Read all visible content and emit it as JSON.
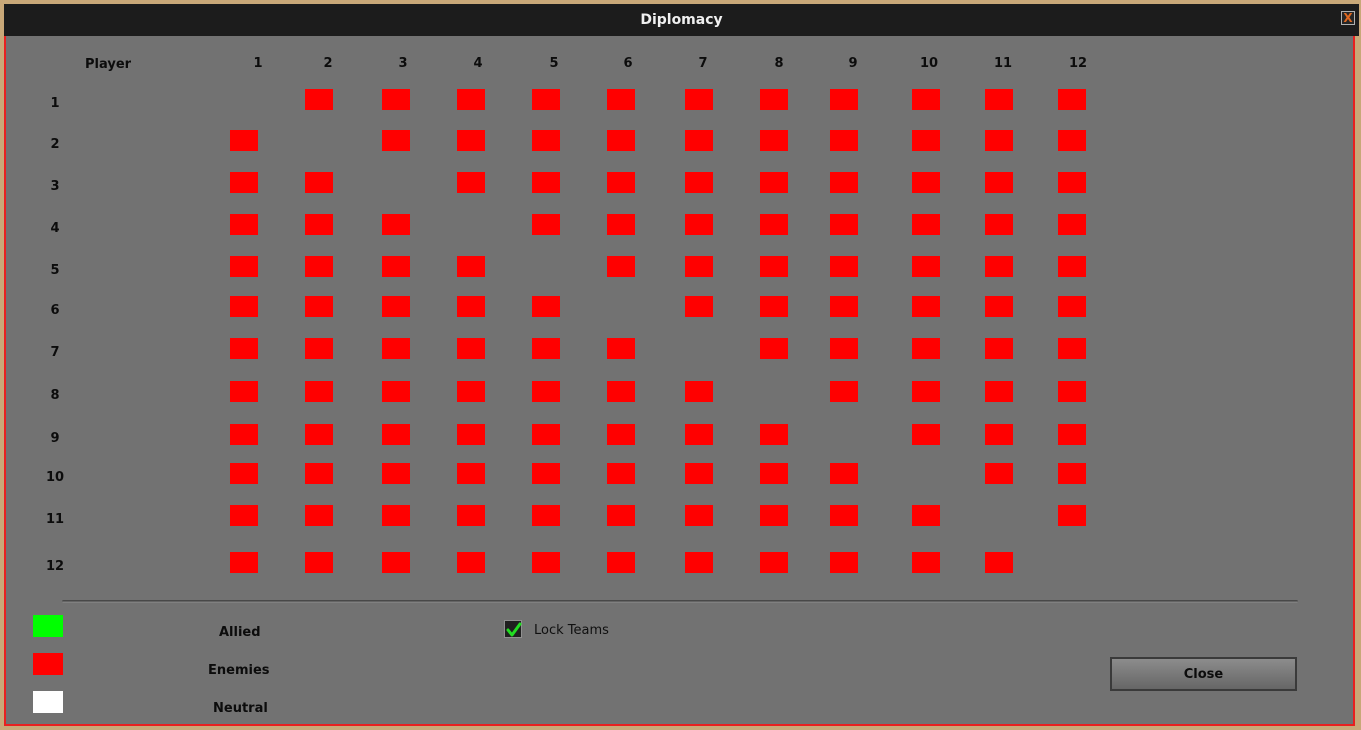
{
  "window": {
    "title": "Diplomacy",
    "close_glyph": "X"
  },
  "matrix": {
    "header": "Player",
    "cols": [
      "1",
      "2",
      "3",
      "4",
      "5",
      "6",
      "7",
      "8",
      "9",
      "10",
      "11",
      "12"
    ],
    "rows": [
      "1",
      "2",
      "3",
      "4",
      "5",
      "6",
      "7",
      "8",
      "9",
      "10",
      "11",
      "12"
    ],
    "relation_grid": [
      [
        "self",
        "enemy",
        "enemy",
        "enemy",
        "enemy",
        "enemy",
        "enemy",
        "enemy",
        "enemy",
        "enemy",
        "enemy",
        "enemy"
      ],
      [
        "enemy",
        "self",
        "enemy",
        "enemy",
        "enemy",
        "enemy",
        "enemy",
        "enemy",
        "enemy",
        "enemy",
        "enemy",
        "enemy"
      ],
      [
        "enemy",
        "enemy",
        "self",
        "enemy",
        "enemy",
        "enemy",
        "enemy",
        "enemy",
        "enemy",
        "enemy",
        "enemy",
        "enemy"
      ],
      [
        "enemy",
        "enemy",
        "enemy",
        "self",
        "enemy",
        "enemy",
        "enemy",
        "enemy",
        "enemy",
        "enemy",
        "enemy",
        "enemy"
      ],
      [
        "enemy",
        "enemy",
        "enemy",
        "enemy",
        "self",
        "enemy",
        "enemy",
        "enemy",
        "enemy",
        "enemy",
        "enemy",
        "enemy"
      ],
      [
        "enemy",
        "enemy",
        "enemy",
        "enemy",
        "enemy",
        "self",
        "enemy",
        "enemy",
        "enemy",
        "enemy",
        "enemy",
        "enemy"
      ],
      [
        "enemy",
        "enemy",
        "enemy",
        "enemy",
        "enemy",
        "enemy",
        "self",
        "enemy",
        "enemy",
        "enemy",
        "enemy",
        "enemy"
      ],
      [
        "enemy",
        "enemy",
        "enemy",
        "enemy",
        "enemy",
        "enemy",
        "enemy",
        "self",
        "enemy",
        "enemy",
        "enemy",
        "enemy"
      ],
      [
        "enemy",
        "enemy",
        "enemy",
        "enemy",
        "enemy",
        "enemy",
        "enemy",
        "enemy",
        "self",
        "enemy",
        "enemy",
        "enemy"
      ],
      [
        "enemy",
        "enemy",
        "enemy",
        "enemy",
        "enemy",
        "enemy",
        "enemy",
        "enemy",
        "enemy",
        "self",
        "enemy",
        "enemy"
      ],
      [
        "enemy",
        "enemy",
        "enemy",
        "enemy",
        "enemy",
        "enemy",
        "enemy",
        "enemy",
        "enemy",
        "enemy",
        "self",
        "enemy"
      ],
      [
        "enemy",
        "enemy",
        "enemy",
        "enemy",
        "enemy",
        "enemy",
        "enemy",
        "enemy",
        "enemy",
        "enemy",
        "enemy",
        "self"
      ]
    ]
  },
  "legend": {
    "allied": {
      "label": "Allied",
      "color": "#00ff00"
    },
    "enemies": {
      "label": "Enemies",
      "color": "#ff0000"
    },
    "neutral": {
      "label": "Neutral",
      "color": "#ffffff"
    }
  },
  "lock_teams": {
    "label": "Lock Teams",
    "checked": true
  },
  "close_button": {
    "label": "Close"
  },
  "colors": {
    "enemy": "#ff0000",
    "allied": "#00ff00",
    "neutral": "#ffffff",
    "check": "#22dd22"
  }
}
